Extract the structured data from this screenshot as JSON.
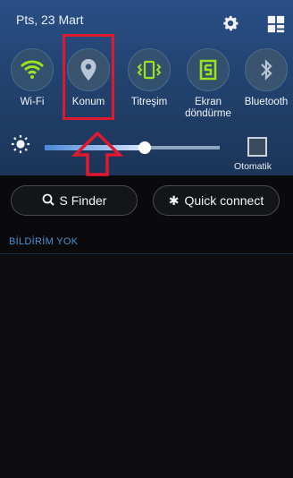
{
  "status": {
    "date": "Pts, 23 Mart"
  },
  "toggles": [
    {
      "label": "Wi-Fi",
      "icon": "wifi-icon",
      "active": true
    },
    {
      "label": "Konum",
      "icon": "location-pin-icon",
      "active": false
    },
    {
      "label": "Titreşim",
      "icon": "vibrate-icon",
      "active": true
    },
    {
      "label": "Ekran döndürme",
      "icon": "rotate-screen-icon",
      "active": true
    },
    {
      "label": "Bluetooth",
      "icon": "bluetooth-icon",
      "active": false
    }
  ],
  "brightness": {
    "level": 0.57,
    "auto_label": "Otomatik",
    "auto_checked": false
  },
  "buttons": {
    "sfinder": "S Finder",
    "quick_connect": "Quick connect"
  },
  "notifications": {
    "empty_label": "BİLDİRİM YOK"
  },
  "colors": {
    "active_green": "#9be21f",
    "panel_blue": "#22426f",
    "highlight_red": "#e0192e",
    "notice_blue": "#4d8fcf"
  }
}
